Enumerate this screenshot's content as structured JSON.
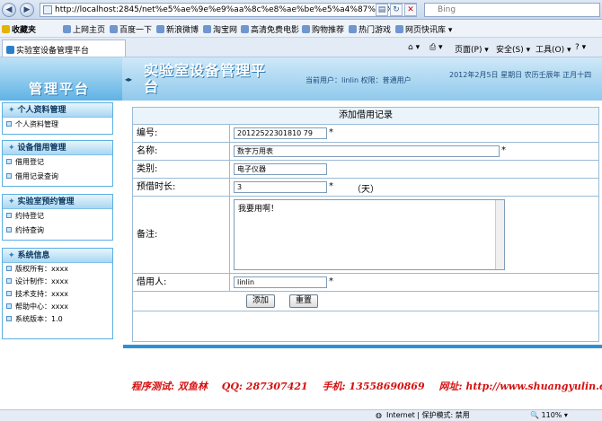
{
  "browser": {
    "address": "http://localhost:2845/net%e5%ae%9e%e9%aa%8c%e8%ae%be%e5%a4%87%e7%",
    "search_placeholder": "Bing",
    "favorites_label": "收藏夹",
    "favorites": [
      "上网主页",
      "百度一下",
      "新浪微博",
      "淘宝网",
      "高清免费电影",
      "购物推荐",
      "热门游戏",
      "网页快讯库 ▾"
    ],
    "tab_title": "实验室设备管理平台",
    "commands": [
      "页面(P) ▾",
      "安全(S) ▾",
      "工具(O) ▾"
    ],
    "status_zone": "Internet | 保护模式: 禁用",
    "zoom": "110%"
  },
  "header": {
    "brand": "管理平台",
    "toggle": "◂▸",
    "title": "实验室设备管理平台",
    "user_label": "当前用户：linlin 权限：普通用户",
    "date": "2012年2月5日 星期日 农历壬辰年 正月十四"
  },
  "sidebar": {
    "groups": [
      {
        "title": "个人资料管理",
        "items": [
          "个人资料管理"
        ]
      },
      {
        "title": "设备借用管理",
        "items": [
          "借用登记",
          "借用记录查询"
        ]
      },
      {
        "title": "实验室预约管理",
        "items": [
          "约持登记",
          "约持查询"
        ]
      },
      {
        "title": "系统信息",
        "items": [
          "版权所有：xxxx",
          "设计制作：xxxx",
          "技术支持：xxxx",
          "帮助中心：xxxx",
          "系统版本：1.0"
        ]
      }
    ]
  },
  "form": {
    "title": "添加借用记录",
    "fields": {
      "id": {
        "label": "编号:",
        "value": "20122522301810 79"
      },
      "name": {
        "label": "名称:",
        "value": "数字万用表"
      },
      "category": {
        "label": "类别:",
        "value": "电子仪器"
      },
      "duration": {
        "label": "预借时长:",
        "value": "3",
        "unit": "（天）"
      },
      "remark": {
        "label": "备注:",
        "value": "我要用啊！"
      },
      "borrower": {
        "label": "借用人:",
        "value": "linlin"
      }
    },
    "required_mark": "*",
    "buttons": {
      "add": "添加",
      "reset": "重置"
    }
  },
  "footer": {
    "tester": "程序测试: 双鱼林",
    "qq": "QQ: 287307421",
    "phone": "手机: 13558690869",
    "site": "网址: http://www.shuangyulin.com"
  }
}
